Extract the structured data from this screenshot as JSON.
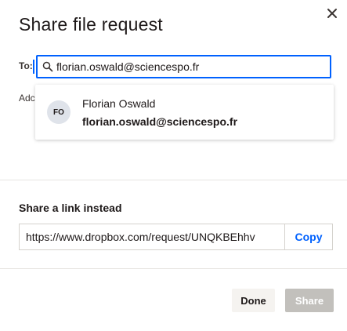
{
  "dialog": {
    "title": "Share file request"
  },
  "to": {
    "label": "To:",
    "value": "florian.oswald@sciencespo.fr",
    "search_icon": "search-icon"
  },
  "add_label": "Adc",
  "suggestion": {
    "initials": "FO",
    "name": "Florian Oswald",
    "email": "florian.oswald@sciencespo.fr"
  },
  "share_link": {
    "title": "Share a link instead",
    "url": "https://www.dropbox.com/request/UNQKBEhhv",
    "copy_label": "Copy"
  },
  "footer": {
    "done_label": "Done",
    "share_label": "Share"
  },
  "colors": {
    "accent": "#0061fe",
    "disabled": "#c2c0bc"
  }
}
